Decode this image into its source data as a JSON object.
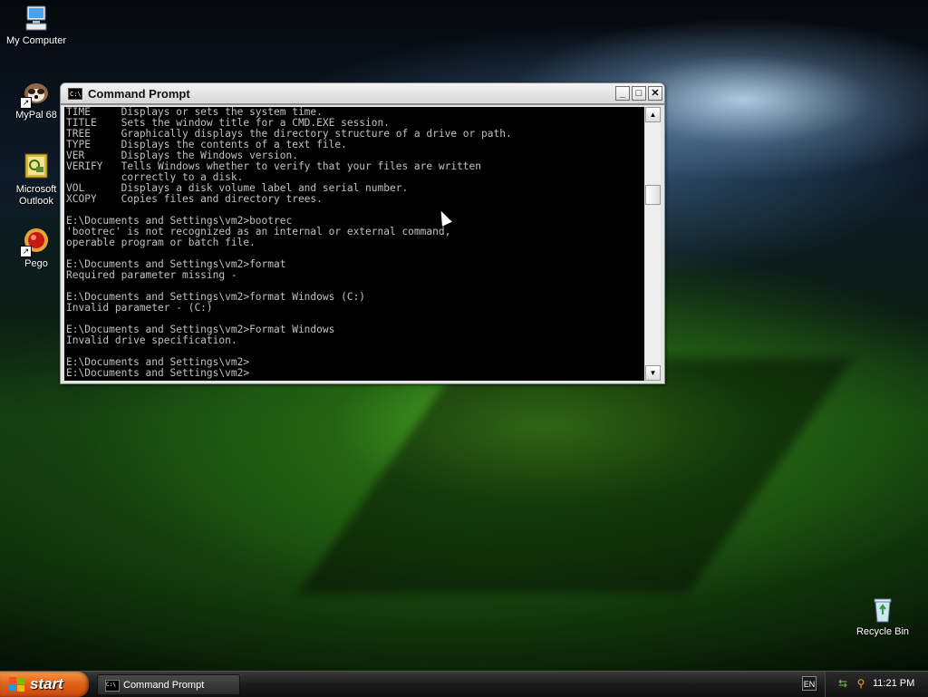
{
  "desktop": {
    "icons": [
      {
        "label": "My Computer",
        "icon": "computer-icon"
      },
      {
        "label": "MyPal 68",
        "icon": "browser-icon"
      },
      {
        "label": "Microsoft Outlook",
        "icon": "outlook-icon"
      },
      {
        "label": "Pego",
        "icon": "pego-icon"
      },
      {
        "label": "Recycle Bin",
        "icon": "recycle-bin-icon"
      }
    ]
  },
  "window": {
    "title": "Command Prompt",
    "icon_text": "C:\\",
    "console_lines": [
      "TIME     Displays or sets the system time.",
      "TITLE    Sets the window title for a CMD.EXE session.",
      "TREE     Graphically displays the directory structure of a drive or path.",
      "TYPE     Displays the contents of a text file.",
      "VER      Displays the Windows version.",
      "VERIFY   Tells Windows whether to verify that your files are written",
      "         correctly to a disk.",
      "VOL      Displays a disk volume label and serial number.",
      "XCOPY    Copies files and directory trees.",
      "",
      "E:\\Documents and Settings\\vm2>bootrec",
      "'bootrec' is not recognized as an internal or external command,",
      "operable program or batch file.",
      "",
      "E:\\Documents and Settings\\vm2>format",
      "Required parameter missing -",
      "",
      "E:\\Documents and Settings\\vm2>format Windows (C:)",
      "Invalid parameter - (C:)",
      "",
      "E:\\Documents and Settings\\vm2>Format Windows",
      "Invalid drive specification.",
      "",
      "E:\\Documents and Settings\\vm2>",
      "E:\\Documents and Settings\\vm2>"
    ]
  },
  "taskbar": {
    "start_label": "start",
    "task_button_label": "Command Prompt",
    "language": "EN",
    "clock": "11:21 PM"
  },
  "colors": {
    "console_bg": "#000000",
    "console_text": "#c0c0c0",
    "start_orange": "#e4641a"
  }
}
